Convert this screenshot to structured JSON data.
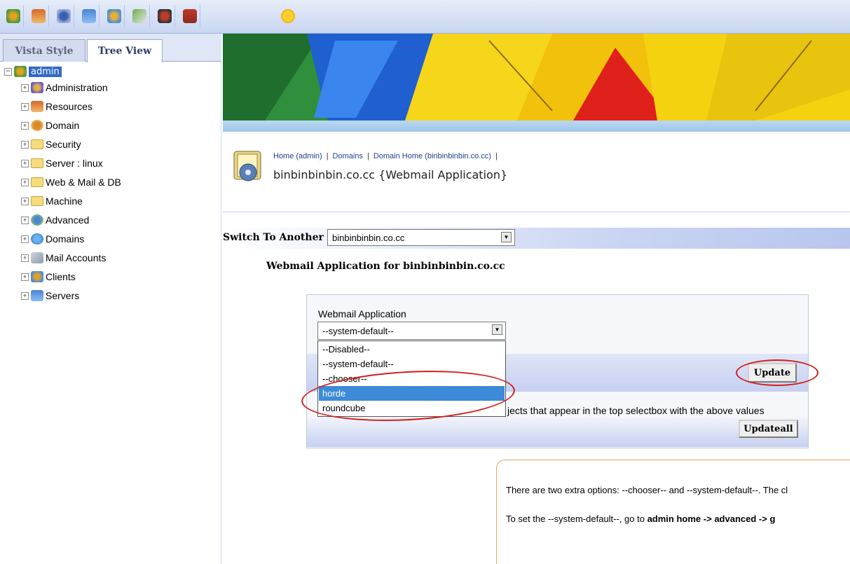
{
  "toolbar": {
    "icons": [
      "user-gear-icon",
      "resources-icon",
      "dashboard-icon",
      "database-icon",
      "user-settings-icon",
      "mail-icon",
      "user-icon",
      "upload-icon",
      "favorite-star-icon"
    ]
  },
  "tabs": {
    "vista": "Vista Style",
    "tree": "Tree View"
  },
  "tree": {
    "root": "admin",
    "items": [
      "Administration",
      "Resources",
      "Domain",
      "Security",
      "Server  : linux",
      "Web & Mail & DB",
      "Machine",
      "Advanced",
      "Domains",
      "Mail Accounts",
      "Clients",
      "Servers"
    ]
  },
  "breadcrumb": {
    "items": [
      "Home (admin)",
      "Domains",
      "Domain Home (binbinbinbin.co.cc)"
    ]
  },
  "page_title": "binbinbinbin.co.cc {Webmail Application}",
  "switch": {
    "label": "Switch To Another",
    "value": "binbinbinbin.co.cc"
  },
  "section_heading": "Webmail Application for binbinbinbin.co.cc",
  "form": {
    "field_label": "Webmail Application",
    "select_value": "--system-default--",
    "options": [
      "--Disabled--",
      "--system-default--",
      "--chooser--",
      "horde",
      "roundcube"
    ],
    "highlighted_option": "horde",
    "update_label": "Update",
    "updateall_text": "jects that appear in the top selectbox with the above values",
    "updateall_label": "Updateall"
  },
  "info": {
    "line1": "There are two extra options: --chooser-- and --system-default--. The cl",
    "line2_prefix": "To set the --system-default--, go to ",
    "line2_b1": "admin home",
    "line2_mid1": " -> ",
    "line2_b2": "advanced",
    "line2_mid2": " -> g"
  },
  "colors": {
    "annotation": "#d41c1c",
    "selection": "#3d8ad8",
    "accent": "#3169c6"
  }
}
